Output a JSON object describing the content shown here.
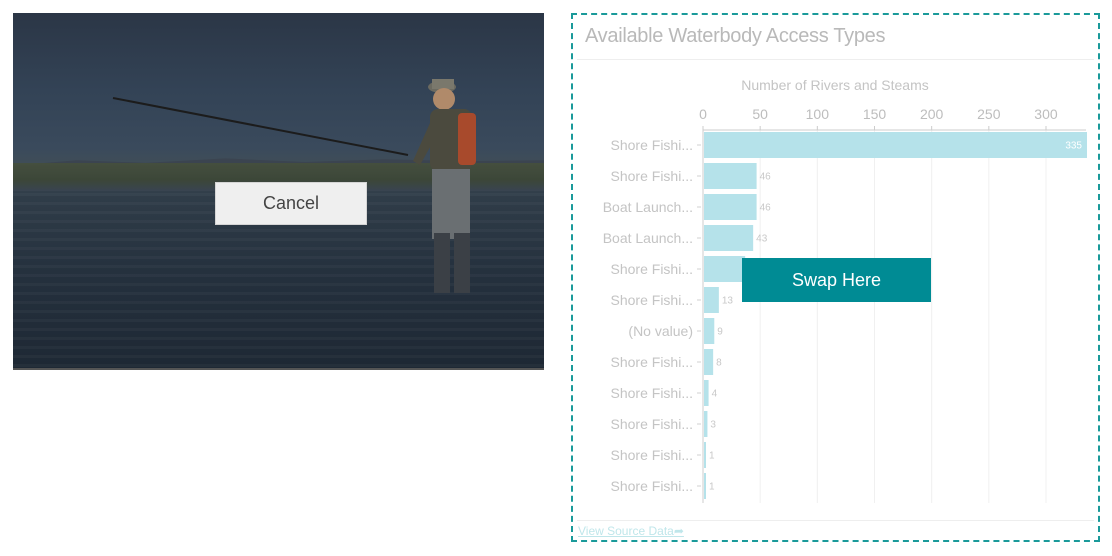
{
  "photo": {
    "cancel_label": "Cancel"
  },
  "panel": {
    "title": "Available Waterbody Access Types",
    "view_source_label": "View Source Data",
    "swap_label": "Swap Here",
    "accent_color": "#008b94",
    "border_color": "#1a9a9a",
    "bar_color": "#b5e2ea"
  },
  "chart_data": {
    "type": "bar",
    "orientation": "horizontal",
    "title": "Number of Rivers and Steams",
    "categories": [
      "Shore Fishi...",
      "Shore Fishi...",
      "Boat Launch...",
      "Boat Launch...",
      "Shore Fishi...",
      "Shore Fishi...",
      "(No value)",
      "Shore Fishi...",
      "Shore Fishi...",
      "Shore Fishi...",
      "Shore Fishi...",
      "Shore Fishi..."
    ],
    "values": [
      335,
      46,
      46,
      43,
      36,
      13,
      9,
      8,
      4,
      3,
      1,
      1
    ],
    "data_labels": [
      "335",
      "46",
      "46",
      "43",
      "",
      "13",
      "9",
      "8",
      "4",
      "3",
      "1",
      "1"
    ],
    "xlim": [
      0,
      335
    ],
    "x_ticks": [
      "0",
      "50",
      "100",
      "150",
      "200",
      "250",
      "300"
    ],
    "x_tick_values": [
      0,
      50,
      100,
      150,
      200,
      250,
      300
    ],
    "axis_position": "top",
    "grid": true
  }
}
